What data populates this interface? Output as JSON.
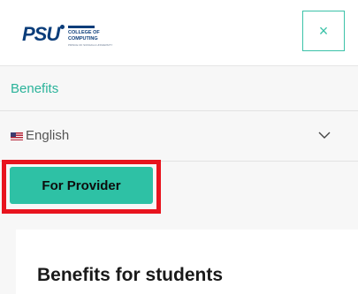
{
  "header": {
    "logo": {
      "mark": "PSU",
      "line1": "COLLEGE OF",
      "line2": "COMPUTING",
      "line3": "PRINCE OF SONGKLA UNIVERSITY"
    },
    "close_icon": "×"
  },
  "nav": {
    "benefits_label": "Benefits",
    "language": {
      "flag_icon": "us-flag-icon",
      "label": "English",
      "chevron_icon": "chevron-down-icon"
    }
  },
  "provider_button": {
    "label": "For Provider"
  },
  "card": {
    "title": "Benefits for students"
  },
  "colors": {
    "accent": "#2ec1a5",
    "link": "#2bb39a",
    "highlight": "#e8141e",
    "brand": "#0b3d7a"
  }
}
